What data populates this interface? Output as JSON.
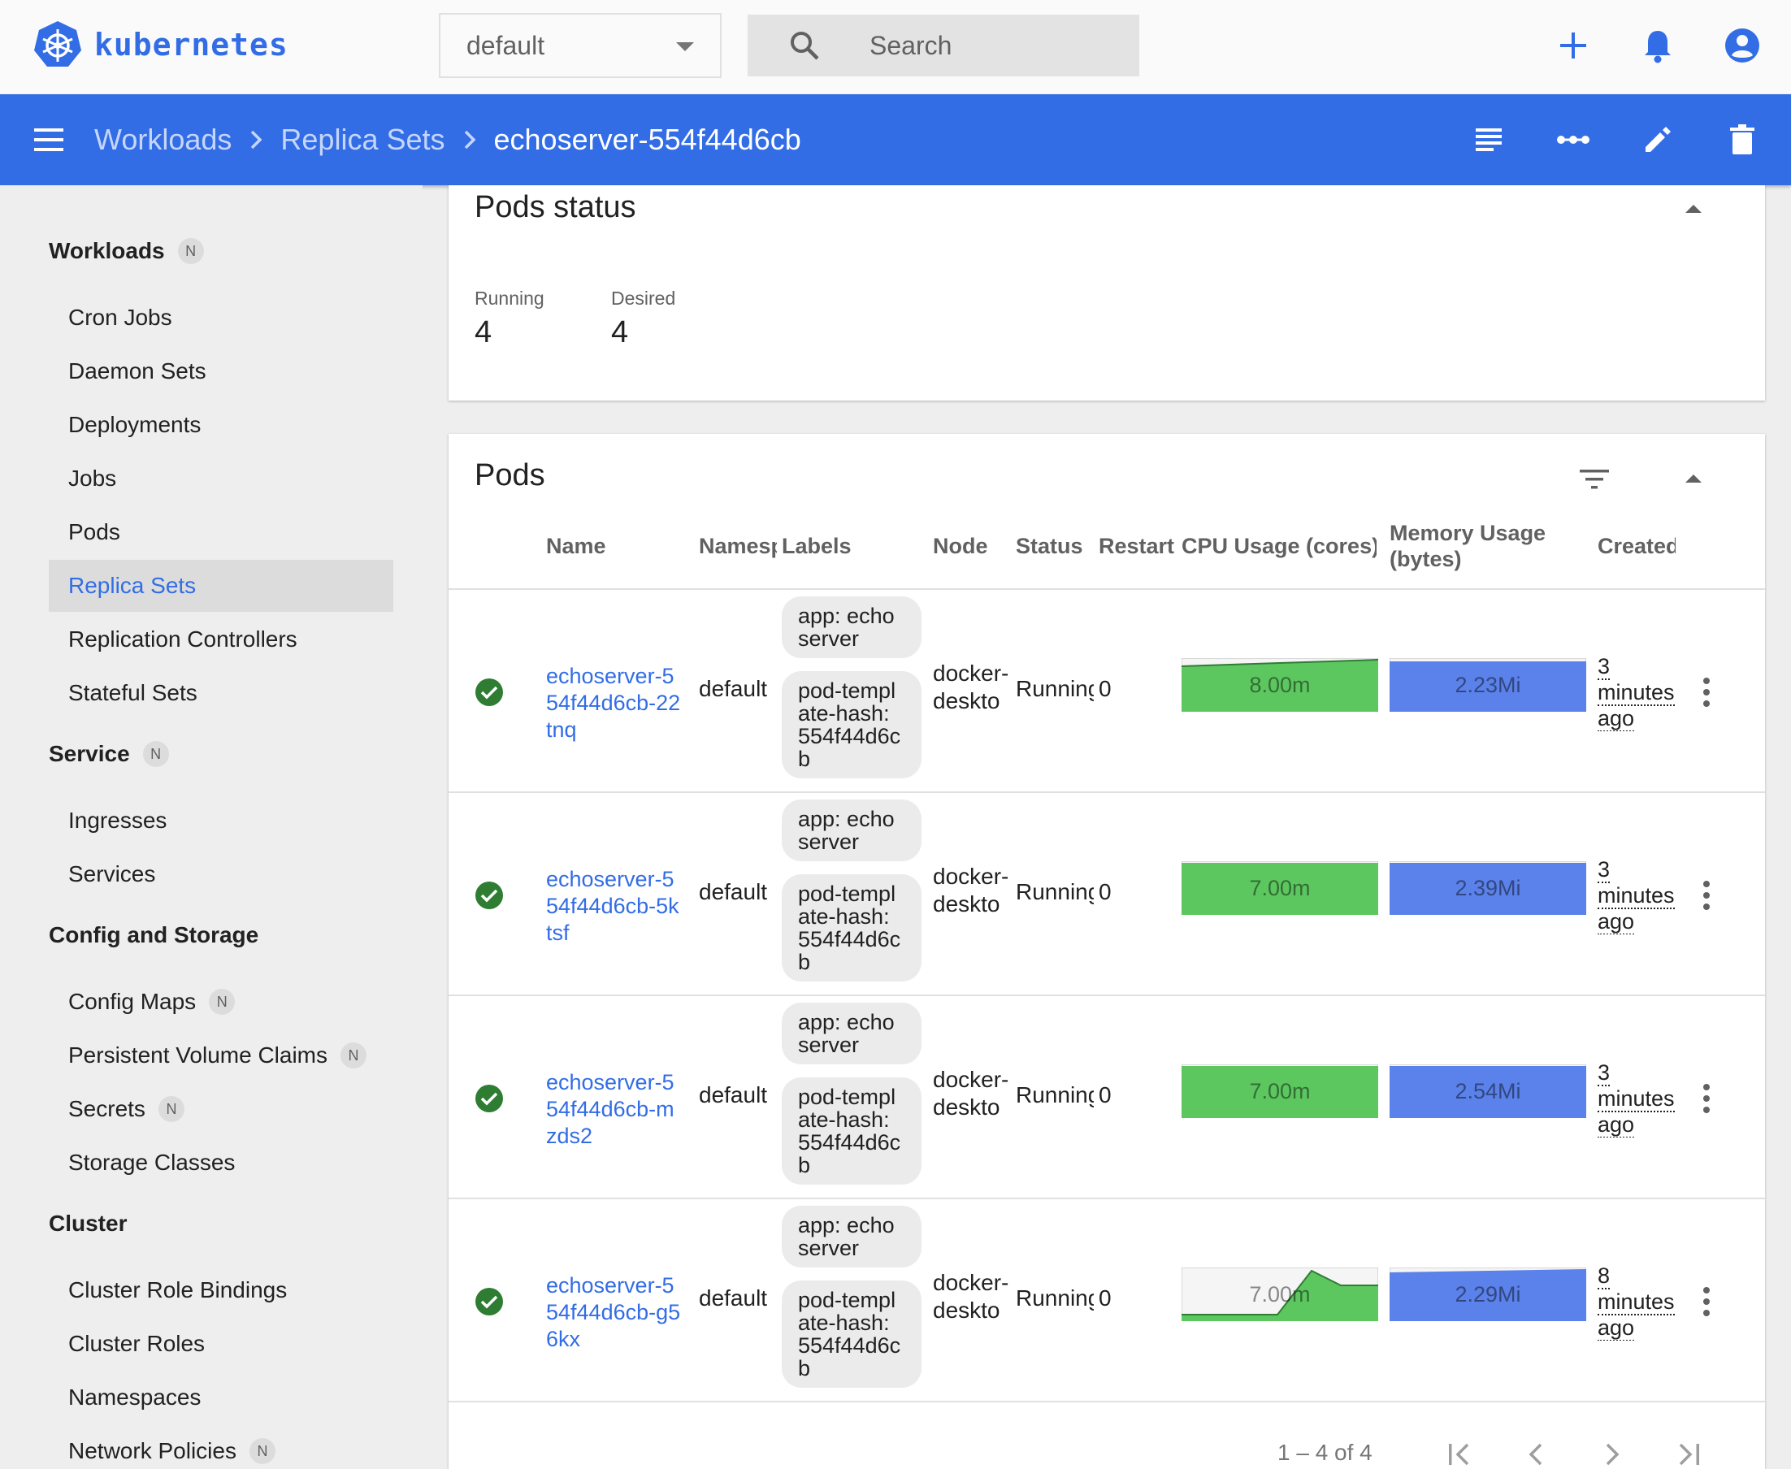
{
  "brand": {
    "name": "kubernetes"
  },
  "namespace": {
    "selected": "default"
  },
  "search": {
    "placeholder": "Search"
  },
  "breadcrumb": {
    "items": [
      "Workloads",
      "Replica Sets"
    ],
    "current": "echoserver-554f44d6cb"
  },
  "sidebar": {
    "groups": [
      {
        "title": "Workloads",
        "badge": "N",
        "items": [
          {
            "label": "Cron Jobs"
          },
          {
            "label": "Daemon Sets"
          },
          {
            "label": "Deployments"
          },
          {
            "label": "Jobs"
          },
          {
            "label": "Pods"
          },
          {
            "label": "Replica Sets",
            "active": true
          },
          {
            "label": "Replication Controllers"
          },
          {
            "label": "Stateful Sets"
          }
        ]
      },
      {
        "title": "Service",
        "badge": "N",
        "items": [
          {
            "label": "Ingresses"
          },
          {
            "label": "Services"
          }
        ]
      },
      {
        "title": "Config and Storage",
        "items": [
          {
            "label": "Config Maps",
            "badge": "N"
          },
          {
            "label": "Persistent Volume Claims",
            "badge": "N"
          },
          {
            "label": "Secrets",
            "badge": "N"
          },
          {
            "label": "Storage Classes"
          }
        ]
      },
      {
        "title": "Cluster",
        "items": [
          {
            "label": "Cluster Role Bindings"
          },
          {
            "label": "Cluster Roles"
          },
          {
            "label": "Namespaces"
          },
          {
            "label": "Network Policies",
            "badge": "N"
          }
        ]
      }
    ]
  },
  "pods_status": {
    "title": "Pods status",
    "running_label": "Running",
    "running": "4",
    "desired_label": "Desired",
    "desired": "4"
  },
  "pods": {
    "title": "Pods",
    "columns": [
      "Name",
      "Namespace",
      "Labels",
      "Node",
      "Status",
      "Restarts",
      "CPU Usage (cores)",
      "Memory Usage (bytes)",
      "Created"
    ],
    "rows": [
      {
        "name": "echoserver-554f44d6cb-22tnq",
        "namespace": "default",
        "label_app": "app: echoserver",
        "label_hash": "pod-template-hash: 554f44d6cb",
        "node": "docker-desktop",
        "status": "Running",
        "restarts": "0",
        "cpu": "8.00m",
        "memory": "2.23Mi",
        "created": [
          "3",
          "minutes",
          "ago"
        ]
      },
      {
        "name": "echoserver-554f44d6cb-5ktsf",
        "namespace": "default",
        "label_app": "app: echoserver",
        "label_hash": "pod-template-hash: 554f44d6cb",
        "node": "docker-desktop",
        "status": "Running",
        "restarts": "0",
        "cpu": "7.00m",
        "memory": "2.39Mi",
        "created": [
          "3",
          "minutes",
          "ago"
        ]
      },
      {
        "name": "echoserver-554f44d6cb-mzds2",
        "namespace": "default",
        "label_app": "app: echoserver",
        "label_hash": "pod-template-hash: 554f44d6cb",
        "node": "docker-desktop",
        "status": "Running",
        "restarts": "0",
        "cpu": "7.00m",
        "memory": "2.54Mi",
        "created": [
          "3",
          "minutes",
          "ago"
        ]
      },
      {
        "name": "echoserver-554f44d6cb-g56kx",
        "namespace": "default",
        "label_app": "app: echoserver",
        "label_hash": "pod-template-hash: 554f44d6cb",
        "node": "docker-desktop",
        "status": "Running",
        "restarts": "0",
        "cpu": "7.00m",
        "memory": "2.29Mi",
        "created": [
          "8",
          "minutes",
          "ago"
        ]
      }
    ],
    "pagination": "1 – 4 of 4"
  },
  "colors": {
    "accent": "#326de6",
    "success": "#2e7d32",
    "cpu": "#4caf50",
    "memory": "#326de6"
  }
}
